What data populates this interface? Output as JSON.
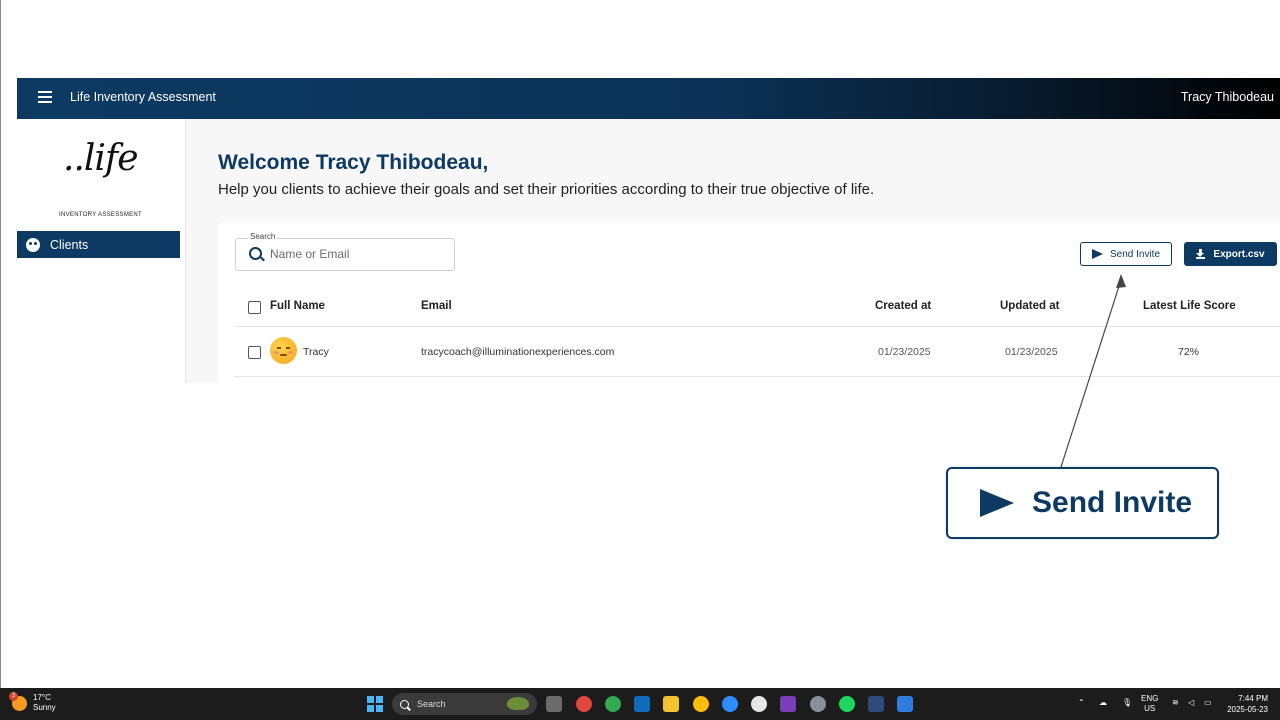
{
  "header": {
    "app_title": "Life Inventory Assessment",
    "user_name": "Tracy Thibodeau"
  },
  "sidebar": {
    "logo_script": "..life",
    "logo_sub": "INVENTORY ASSESSMENT",
    "items": [
      {
        "label": "Clients",
        "icon": "clients-icon"
      }
    ]
  },
  "main": {
    "welcome": "Welcome Tracy Thibodeau,",
    "subtitle": "Help you clients to achieve their goals and set their priorities according to their true objective of life.",
    "search": {
      "label": "Search",
      "placeholder": "Name or Email",
      "value": ""
    },
    "buttons": {
      "send_invite": "Send Invite",
      "export": "Export.csv"
    },
    "table": {
      "columns": [
        "Full Name",
        "Email",
        "Created at",
        "Updated at",
        "Latest Life Score"
      ],
      "rows": [
        {
          "name": "Tracy",
          "email": "tracycoach@illuminationexperiences.com",
          "created": "01/23/2025",
          "updated": "01/23/2025",
          "score": "72%"
        }
      ]
    }
  },
  "callout": {
    "label": "Send Invite"
  },
  "taskbar": {
    "weather_temp": "17°C",
    "weather_desc": "Sunny",
    "weather_badge": "3",
    "search_label": "Search",
    "lang": "ENG",
    "region": "US",
    "time": "7:44 PM",
    "date": "2025-05-23"
  },
  "colors": {
    "primary": "#0d3a63",
    "taskbar": "#1c1c1c"
  }
}
